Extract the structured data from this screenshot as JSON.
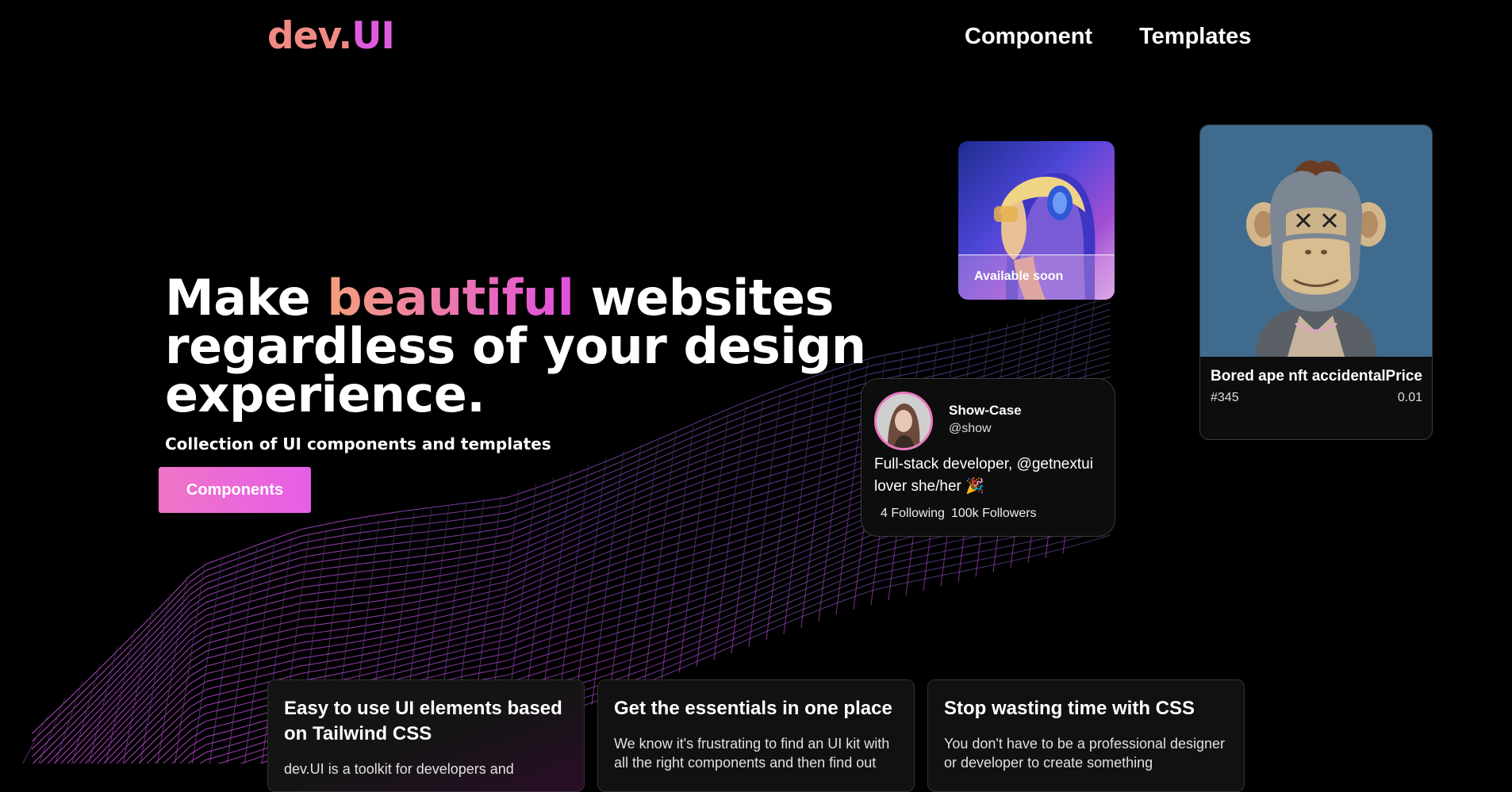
{
  "nav": {
    "logo_part1": "dev.",
    "logo_part2": "UI",
    "links": [
      {
        "label": "Component"
      },
      {
        "label": "Templates"
      }
    ]
  },
  "hero": {
    "title_word1": "Make ",
    "title_accent": "beautiful",
    "title_rest1": " websites",
    "title_line2": "regardless of your design",
    "title_line3": "experience.",
    "subtitle": "Collection of UI components and templates",
    "cta_label": "Components"
  },
  "music_card": {
    "label": "Available soon"
  },
  "nft_card": {
    "title": "Bored ape nft accidental",
    "price_label": "Price",
    "id": "#345",
    "price": "0.01"
  },
  "profile_card": {
    "name": "Show-Case",
    "handle": "@show",
    "bio": "Full-stack developer, @getnextui lover she/her 🎉",
    "following": "4 Following",
    "followers": "100k Followers"
  },
  "features": [
    {
      "title": "Easy to use UI elements based on Tailwind CSS",
      "text": "dev.UI is a toolkit for developers and"
    },
    {
      "title": "Get the essentials in one place",
      "text": "We know it's frustrating to find an UI kit with all the right components and then find out"
    },
    {
      "title": "Stop wasting time with CSS",
      "text": "You don't have to be a professional designer or developer to create something"
    }
  ],
  "colors": {
    "background": "#000000",
    "logo_dev": "#f08a84",
    "logo_ui": "#e05adf",
    "accent_gradient_start": "#f4a07b",
    "accent_gradient_end": "#e24ee0",
    "button": "#e96ad8",
    "card_bg": "#0d0d0d",
    "nft_bg": "#3f6c8e"
  }
}
